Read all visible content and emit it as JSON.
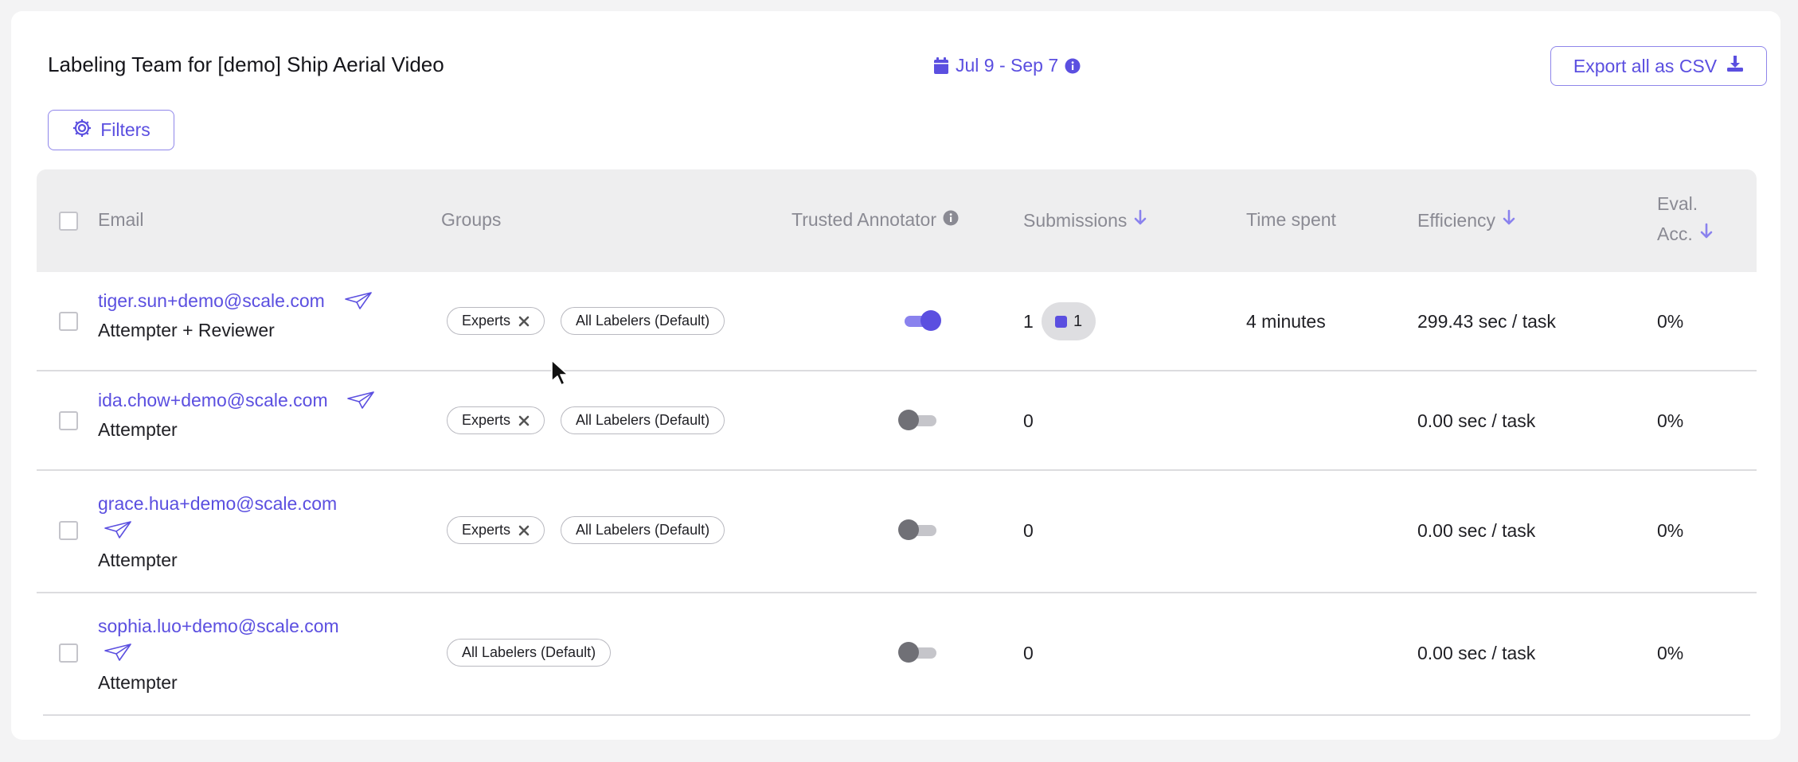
{
  "header": {
    "title": "Labeling Team for [demo] Ship Aerial Video",
    "date_range": "Jul 9 - Sep 7",
    "export_label": "Export all as CSV",
    "filters_label": "Filters"
  },
  "table": {
    "columns": {
      "email": "Email",
      "groups": "Groups",
      "trusted": "Trusted Annotator",
      "submissions": "Submissions",
      "time_spent": "Time spent",
      "efficiency": "Efficiency",
      "eval_acc_line1": "Eval.",
      "eval_acc_line2": "Acc."
    },
    "rows": [
      {
        "email": "tiger.sun+demo@scale.com",
        "role": "Attempter + Reviewer",
        "groups": [
          "Experts",
          "All Labelers (Default)"
        ],
        "trusted": true,
        "submissions": "1",
        "submission_badge": "1",
        "time_spent": "4 minutes",
        "efficiency": "299.43 sec / task",
        "eval_acc": "0%"
      },
      {
        "email": "ida.chow+demo@scale.com",
        "role": "Attempter",
        "groups": [
          "Experts",
          "All Labelers (Default)"
        ],
        "trusted": false,
        "submissions": "0",
        "time_spent": "",
        "efficiency": "0.00 sec / task",
        "eval_acc": "0%"
      },
      {
        "email": "grace.hua+demo@scale.com",
        "role": "Attempter",
        "groups": [
          "Experts",
          "All Labelers (Default)"
        ],
        "trusted": false,
        "submissions": "0",
        "time_spent": "",
        "efficiency": "0.00 sec / task",
        "eval_acc": "0%"
      },
      {
        "email": "sophia.luo+demo@scale.com",
        "role": "Attempter",
        "groups": [
          "All Labelers (Default)"
        ],
        "trusted": false,
        "submissions": "0",
        "time_spent": "",
        "efficiency": "0.00 sec / task",
        "eval_acc": "0%"
      }
    ]
  },
  "colors": {
    "accent": "#5b4fe0",
    "header_bg": "#eeeeef",
    "toggle_off": "#707076"
  },
  "icons": {
    "date": "calendar-icon",
    "info": "info-icon",
    "export": "download-icon",
    "filters": "gear-icon",
    "sort": "arrow-down-icon",
    "invite": "paper-plane-icon",
    "remove_group": "close-icon",
    "cursor": "mouse-cursor-icon"
  }
}
